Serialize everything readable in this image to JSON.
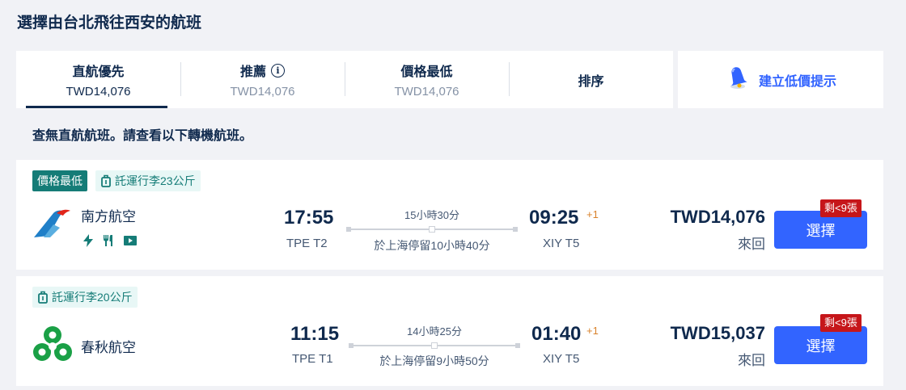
{
  "page_title": "選擇由台北飛往西安的航班",
  "sort_tabs": [
    {
      "label": "直航優先",
      "price": "TWD14,076",
      "active": true
    },
    {
      "label": "推薦",
      "price": "TWD14,076",
      "has_info_icon": true
    },
    {
      "label": "價格最低",
      "price": "TWD14,076"
    },
    {
      "label": "排序",
      "price": ""
    }
  ],
  "price_alert": {
    "label": "建立低價提示",
    "icon": "bell-icon"
  },
  "no_direct_message": "查無直航航班。請查看以下轉機航班。",
  "flights": [
    {
      "tags": {
        "cheapest": "價格最低",
        "baggage": "託運行李23公斤"
      },
      "airline": "南方航空",
      "airline_logo": "china-southern-logo",
      "amenities": [
        "power-icon",
        "meal-icon",
        "entertainment-icon"
      ],
      "departure_time": "17:55",
      "departure_airport": "TPE T2",
      "duration": "15小時30分",
      "stopover": "於上海停留10小時40分",
      "arrival_time": "09:25",
      "arrival_day_offset": "+1",
      "arrival_airport": "XIY T5",
      "price": "TWD14,076",
      "trip_type": "來回",
      "seats_left": "剩<9張",
      "select_label": "選擇"
    },
    {
      "tags": {
        "baggage": "託運行李20公斤"
      },
      "airline": "春秋航空",
      "airline_logo": "spring-airlines-logo",
      "amenities": [],
      "departure_time": "11:15",
      "departure_airport": "TPE T1",
      "duration": "14小時25分",
      "stopover": "於上海停留9小時50分",
      "arrival_time": "01:40",
      "arrival_day_offset": "+1",
      "arrival_airport": "XIY T5",
      "price": "TWD15,037",
      "trip_type": "來回",
      "seats_left": "剩<9張",
      "select_label": "選擇"
    }
  ],
  "colors": {
    "brand_blue": "#3264ff",
    "teal": "#157c77",
    "alert_red": "#c6161a",
    "navy": "#0f294d"
  }
}
